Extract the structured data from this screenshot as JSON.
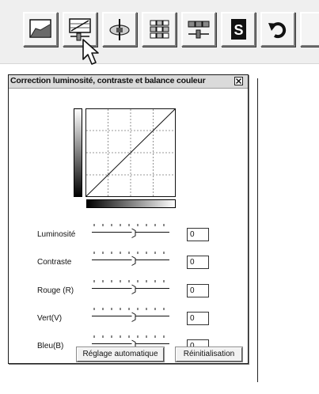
{
  "toolbar": {
    "buttons": [
      {
        "icon": "tone-curve-icon"
      },
      {
        "icon": "brightness-contrast-icon"
      },
      {
        "icon": "hue-saturation-icon"
      },
      {
        "icon": "variations-icon"
      },
      {
        "icon": "color-balance-icon"
      },
      {
        "icon": "selective-color-icon"
      },
      {
        "icon": "undo-icon"
      }
    ]
  },
  "dialog": {
    "title": "Correction luminosité, contraste et balance couleur",
    "sliders": [
      {
        "label": "Luminosité",
        "value": "0"
      },
      {
        "label": "Contraste",
        "value": "0"
      },
      {
        "label": "Rouge (R)",
        "value": "0"
      },
      {
        "label": "Vert(V)",
        "value": "0"
      },
      {
        "label": "Bleu(B)",
        "value": "0"
      }
    ],
    "auto_button": "Réglage automatique",
    "reset_button": "Réinitialisation"
  }
}
